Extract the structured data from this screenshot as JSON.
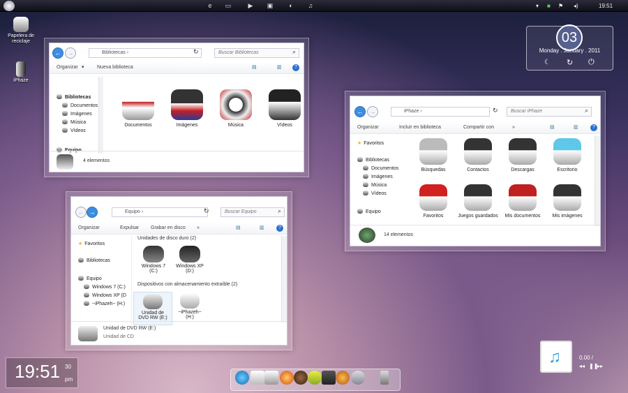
{
  "taskbar": {
    "time": "19:51"
  },
  "desktop": {
    "icons": [
      {
        "label": "Papelera de reciclaje"
      },
      {
        "label": "iPhaze"
      }
    ]
  },
  "clock_widget": {
    "day": "03",
    "date": "Monday . January . 2011"
  },
  "bottom_clock": {
    "time": "19:51",
    "seconds": "30",
    "ampm": "pm"
  },
  "music": {
    "time": "0.00 /"
  },
  "win_libraries": {
    "search_placeholder": "Buscar Bibliotecas",
    "breadcrumb": "Bibliotecas",
    "toolbar": {
      "organize": "Organizar",
      "new_library": "Nueva biblioteca"
    },
    "sidebar": [
      "Bibliotecas",
      "Documentos",
      "Imágenes",
      "Música",
      "Vídeos",
      "Equipo"
    ],
    "tiles": [
      "Documentos",
      "Imágenes",
      "Música",
      "Vídeos"
    ],
    "status": "4 elementos"
  },
  "win_computer": {
    "search_placeholder": "Buscar Equipo",
    "breadcrumb": "Equipo",
    "toolbar": {
      "organize": "Organizar",
      "eject": "Expulsar",
      "burn": "Grabar en disco",
      "more": "»"
    },
    "sidebar": [
      "Favoritos",
      "Bibliotecas",
      "Equipo",
      "Windows 7 (C:)",
      "Windows XP (D",
      "~iPhazeh~ (H:)"
    ],
    "group_hdd": "Unidades de disco duro (2)",
    "drives": [
      {
        "name": "Windows 7",
        "sub": "(C:)"
      },
      {
        "name": "Windows XP",
        "sub": "(D:)"
      }
    ],
    "group_removable": "Dispositivos con almacenamiento extraíble (2)",
    "removable": [
      {
        "name": "Unidad de",
        "sub": "DVD RW (E:)"
      },
      {
        "name": "~iPhazeh~",
        "sub": "(H:)"
      }
    ],
    "status_title": "Unidad de DVD RW (E:)",
    "status_sub": "Unidad de CD"
  },
  "win_iphaze": {
    "search_placeholder": "Buscar iPhaze",
    "breadcrumb": "iPhaze",
    "toolbar": {
      "organize": "Organizar",
      "include": "Incluir en biblioteca",
      "share": "Compartir con",
      "more": "»"
    },
    "sidebar": [
      "Favoritos",
      "Bibliotecas",
      "Documentos",
      "Imágenes",
      "Música",
      "Vídeos",
      "Equipo"
    ],
    "tiles": [
      {
        "label": "Búsquedas",
        "color": "#bbbbbb"
      },
      {
        "label": "Contactos",
        "color": "#333333"
      },
      {
        "label": "Descargas",
        "color": "#333333"
      },
      {
        "label": "Escritorio",
        "color": "#5fc8e8"
      },
      {
        "label": "Favoritos",
        "color": "#d02020"
      },
      {
        "label": "Juegos guardados",
        "color": "#333333"
      },
      {
        "label": "Mis documentos",
        "color": "#c02020"
      },
      {
        "label": "Mis imágenes",
        "color": "#333333"
      }
    ],
    "status": "14 elementos"
  }
}
